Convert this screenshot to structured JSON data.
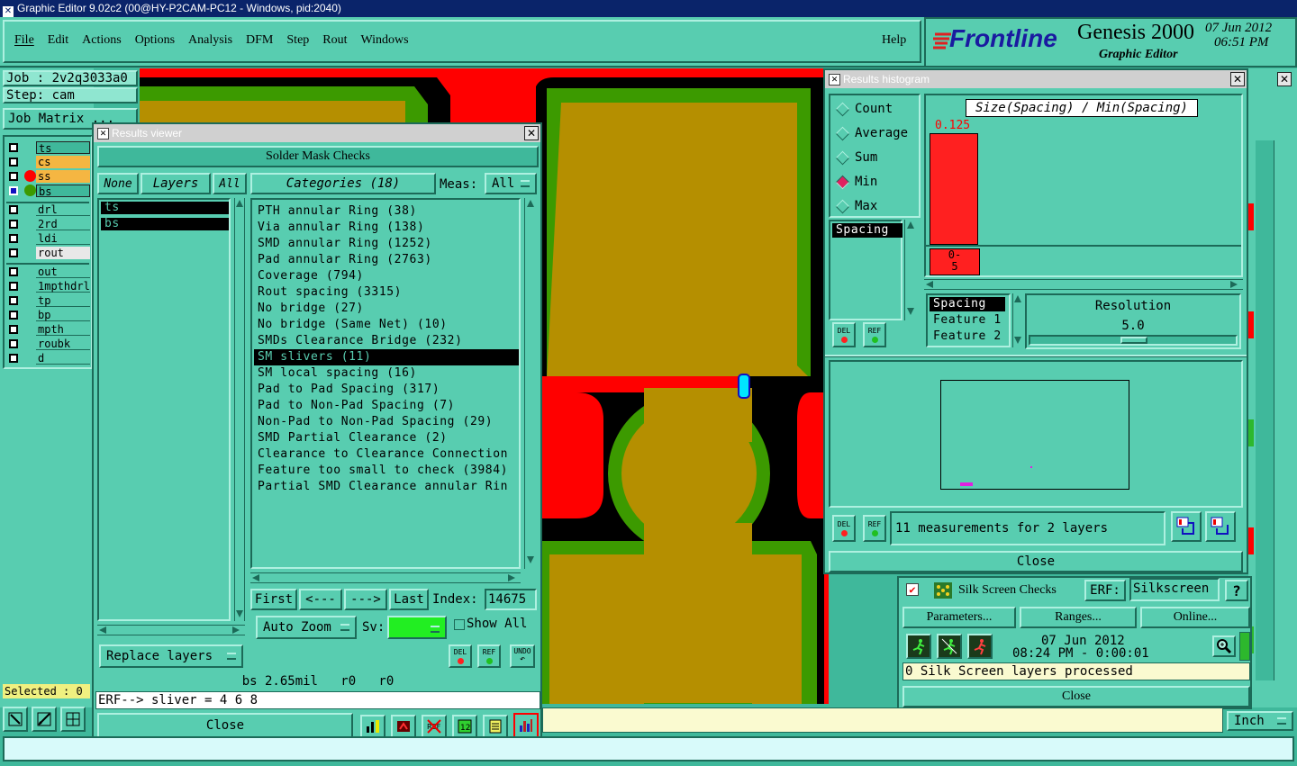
{
  "window": {
    "title": "Graphic Editor 9.02c2 (00@HY-P2CAM-PC12 - Windows, pid:2040)"
  },
  "menu": {
    "items": [
      "File",
      "Edit",
      "Actions",
      "Options",
      "Analysis",
      "DFM",
      "Step",
      "Rout",
      "Windows"
    ],
    "help": "Help"
  },
  "brand": {
    "logo": "Frontline",
    "product": "Genesis 2000",
    "sub": "Graphic Editor",
    "date": "07 Jun 2012",
    "time": "06:51 PM"
  },
  "job": {
    "job_label": "Job : 2v2q3033a0",
    "step_label": "Step: cam",
    "matrix_button": "Job Matrix ..."
  },
  "layers": {
    "group1": [
      {
        "name": "ts",
        "bg": "#3fb89b",
        "dot": ""
      },
      {
        "name": "cs",
        "bg": "#f5b642",
        "dot": ""
      },
      {
        "name": "ss",
        "bg": "#f5b642",
        "dot": "#ff0000"
      },
      {
        "name": "bs",
        "bg": "#3fb89b",
        "dot": "#3c9a00"
      }
    ],
    "group2": [
      {
        "name": "drl"
      },
      {
        "name": "2rd"
      },
      {
        "name": "ldi"
      },
      {
        "name": "rout"
      }
    ],
    "group3": [
      {
        "name": "out"
      },
      {
        "name": "1mpthdrl"
      },
      {
        "name": "tp"
      },
      {
        "name": "bp"
      },
      {
        "name": "mpth"
      },
      {
        "name": "roubk"
      },
      {
        "name": "d"
      }
    ],
    "selected": "Selected : 0"
  },
  "results_viewer": {
    "title": "Results viewer",
    "header": "Solder Mask Checks",
    "none_btn": "None",
    "layers_btn": "Layers",
    "all_btn": "All",
    "layer_list": [
      "ts",
      "bs"
    ],
    "categories_btn": "Categories (18)",
    "meas_label": "Meas:",
    "meas_value": "All",
    "categories": [
      "PTH annular Ring (38)",
      "Via annular Ring (138)",
      "SMD annular Ring (1252)",
      "Pad annular Ring (2763)",
      "Coverage (794)",
      "Rout spacing (3315)",
      "No bridge (27)",
      "No bridge (Same Net) (10)",
      "SMDs Clearance Bridge (232)",
      "SM slivers (11)",
      "SM local spacing (16)",
      "Pad to Pad Spacing (317)",
      "Pad to Non-Pad Spacing (7)",
      "Non-Pad to Non-Pad Spacing (29)",
      "SMD Partial Clearance (2)",
      "Clearance to Clearance Connection",
      "Feature too small to check (3984)",
      "Partial SMD Clearance annular Rin"
    ],
    "selected_category": 9,
    "first_btn": "First",
    "prev_btn": "<---",
    "next_btn": "--->",
    "last_btn": "Last",
    "index_label": "Index:",
    "index_value": "14675",
    "autozoom_btn": "Auto Zoom",
    "sv_label": "Sv:",
    "showall_label": "Show All",
    "replace_btn": "Replace layers",
    "del_label": "DEL",
    "ref_label": "REF",
    "undo_label": "UNDO",
    "status": "bs 2.65mil   r0   r0",
    "erf_line": "ERF--> sliver = 4 6 8",
    "close_btn": "Close",
    "sv_color": "#22ee22"
  },
  "histogram": {
    "title": "Results histogram",
    "options": [
      {
        "label": "Count",
        "selected": false
      },
      {
        "label": "Average",
        "selected": false
      },
      {
        "label": "Sum",
        "selected": false
      },
      {
        "label": "Min",
        "selected": true
      },
      {
        "label": "Max",
        "selected": false
      }
    ],
    "chart_title": "Size(Spacing) / Min(Spacing)",
    "max_value": "0.125",
    "x_label_a": "0-",
    "x_label_b": "5",
    "measure_list": [
      "Spacing"
    ],
    "feature_list": [
      "Spacing",
      "Feature 1",
      "Feature 2"
    ],
    "resolution_label": "Resolution",
    "resolution_value": "5.0",
    "summary": "11 measurements for 2 layers",
    "del_label": "DEL",
    "ref_label": "REF",
    "close_btn": "Close"
  },
  "silk": {
    "title": "Silk Screen Checks",
    "erf_label": "ERF:",
    "erf_value": "Silkscreen",
    "help_btn": "?",
    "parameters_btn": "Parameters...",
    "ranges_btn": "Ranges...",
    "online_btn": "Online...",
    "date": "07 Jun 2012",
    "time": "08:24 PM - 0:00:01",
    "status": "0 Silk Screen layers processed",
    "close_btn": "Close"
  },
  "bottom": {
    "units": "Inch"
  }
}
